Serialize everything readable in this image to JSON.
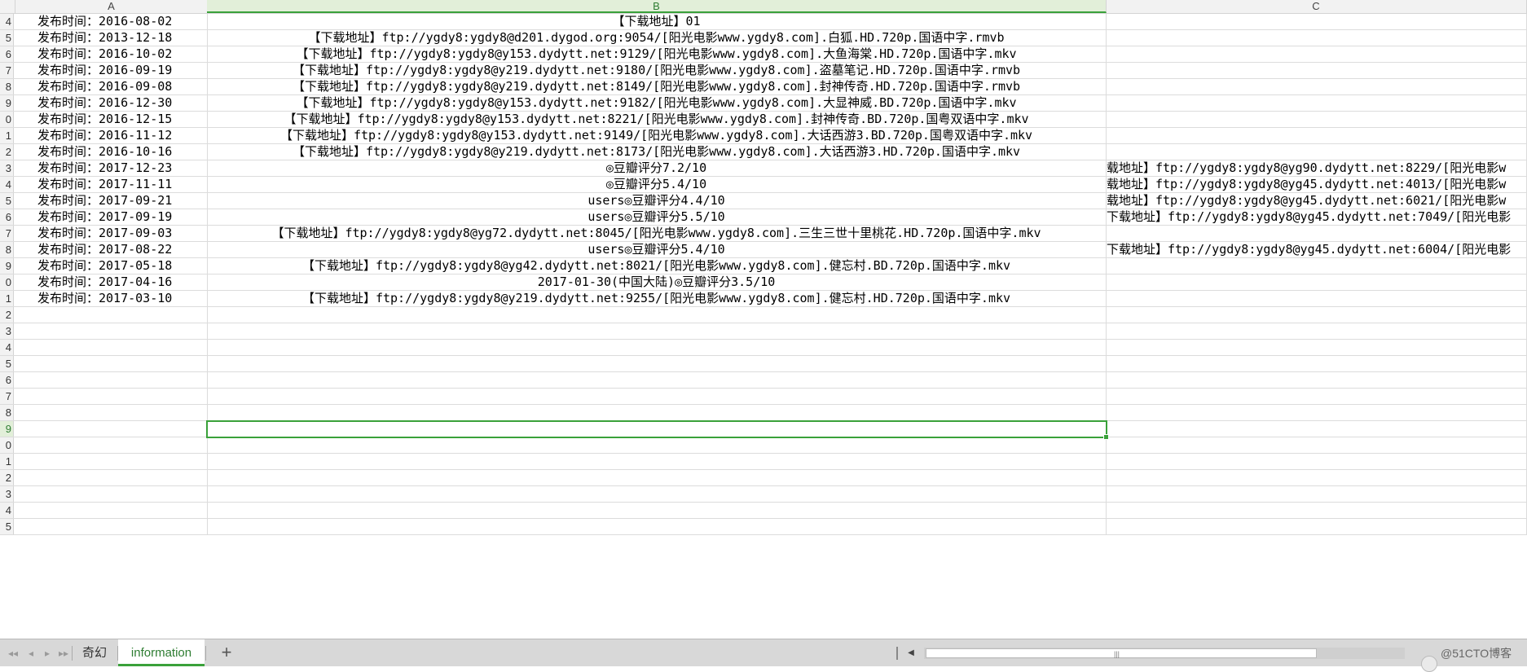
{
  "columns": {
    "a": "A",
    "b": "B",
    "c": "C"
  },
  "rows": [
    {
      "num": "4",
      "a": "发布时间：2016-08-02",
      "b": "【下载地址】01",
      "c": ""
    },
    {
      "num": "5",
      "a": "发布时间：2013-12-18",
      "b": "【下载地址】ftp://ygdy8:ygdy8@d201.dygod.org:9054/[阳光电影www.ygdy8.com].白狐.HD.720p.国语中字.rmvb",
      "c": ""
    },
    {
      "num": "6",
      "a": "发布时间：2016-10-02",
      "b": "【下载地址】ftp://ygdy8:ygdy8@y153.dydytt.net:9129/[阳光电影www.ygdy8.com].大鱼海棠.HD.720p.国语中字.mkv",
      "c": ""
    },
    {
      "num": "7",
      "a": "发布时间：2016-09-19",
      "b": "【下载地址】ftp://ygdy8:ygdy8@y219.dydytt.net:9180/[阳光电影www.ygdy8.com].盗墓笔记.HD.720p.国语中字.rmvb",
      "c": ""
    },
    {
      "num": "8",
      "a": "发布时间：2016-09-08",
      "b": "【下载地址】ftp://ygdy8:ygdy8@y219.dydytt.net:8149/[阳光电影www.ygdy8.com].封神传奇.HD.720p.国语中字.rmvb",
      "c": ""
    },
    {
      "num": "9",
      "a": "发布时间：2016-12-30",
      "b": "【下载地址】ftp://ygdy8:ygdy8@y153.dydytt.net:9182/[阳光电影www.ygdy8.com].大显神威.BD.720p.国语中字.mkv",
      "c": ""
    },
    {
      "num": "0",
      "a": "发布时间：2016-12-15",
      "b": "【下载地址】ftp://ygdy8:ygdy8@y153.dydytt.net:8221/[阳光电影www.ygdy8.com].封神传奇.BD.720p.国粤双语中字.mkv",
      "c": ""
    },
    {
      "num": "1",
      "a": "发布时间：2016-11-12",
      "b": "【下载地址】ftp://ygdy8:ygdy8@y153.dydytt.net:9149/[阳光电影www.ygdy8.com].大话西游3.BD.720p.国粤双语中字.mkv",
      "c": ""
    },
    {
      "num": "2",
      "a": "发布时间：2016-10-16",
      "b": "【下载地址】ftp://ygdy8:ygdy8@y219.dydytt.net:8173/[阳光电影www.ygdy8.com].大话西游3.HD.720p.国语中字.mkv",
      "c": ""
    },
    {
      "num": "3",
      "a": "发布时间：2017-12-23",
      "b": "◎豆瓣评分7.2/10",
      "c": "载地址】ftp://ygdy8:ygdy8@yg90.dydytt.net:8229/[阳光电影w"
    },
    {
      "num": "4",
      "a": "发布时间：2017-11-11",
      "b": "◎豆瓣评分5.4/10",
      "c": "载地址】ftp://ygdy8:ygdy8@yg45.dydytt.net:4013/[阳光电影w"
    },
    {
      "num": "5",
      "a": "发布时间：2017-09-21",
      "b": "users◎豆瓣评分4.4/10",
      "c": "载地址】ftp://ygdy8:ygdy8@yg45.dydytt.net:6021/[阳光电影w"
    },
    {
      "num": "6",
      "a": "发布时间：2017-09-19",
      "b": "users◎豆瓣评分5.5/10",
      "c": "下载地址】ftp://ygdy8:ygdy8@yg45.dydytt.net:7049/[阳光电影"
    },
    {
      "num": "7",
      "a": "发布时间：2017-09-03",
      "b": "【下载地址】ftp://ygdy8:ygdy8@yg72.dydytt.net:8045/[阳光电影www.ygdy8.com].三生三世十里桃花.HD.720p.国语中字.mkv",
      "c": ""
    },
    {
      "num": "8",
      "a": "发布时间：2017-08-22",
      "b": "users◎豆瓣评分5.4/10",
      "c": "下载地址】ftp://ygdy8:ygdy8@yg45.dydytt.net:6004/[阳光电影"
    },
    {
      "num": "9",
      "a": "发布时间：2017-05-18",
      "b": "【下载地址】ftp://ygdy8:ygdy8@yg42.dydytt.net:8021/[阳光电影www.ygdy8.com].健忘村.BD.720p.国语中字.mkv",
      "c": ""
    },
    {
      "num": "0",
      "a": "发布时间：2017-04-16",
      "b": "2017-01-30(中国大陆)◎豆瓣评分3.5/10",
      "c": ""
    },
    {
      "num": "1",
      "a": "发布时间：2017-03-10",
      "b": "【下载地址】ftp://ygdy8:ygdy8@y219.dydytt.net:9255/[阳光电影www.ygdy8.com].健忘村.HD.720p.国语中字.mkv",
      "c": ""
    },
    {
      "num": "2",
      "a": "",
      "b": "",
      "c": ""
    },
    {
      "num": "3",
      "a": "",
      "b": "",
      "c": ""
    },
    {
      "num": "4",
      "a": "",
      "b": "",
      "c": ""
    },
    {
      "num": "5",
      "a": "",
      "b": "",
      "c": ""
    },
    {
      "num": "6",
      "a": "",
      "b": "",
      "c": ""
    },
    {
      "num": "7",
      "a": "",
      "b": "",
      "c": ""
    },
    {
      "num": "8",
      "a": "",
      "b": "",
      "c": ""
    },
    {
      "num": "9",
      "a": "",
      "b": "",
      "c": "",
      "selected": true
    },
    {
      "num": "0",
      "a": "",
      "b": "",
      "c": ""
    },
    {
      "num": "1",
      "a": "",
      "b": "",
      "c": ""
    },
    {
      "num": "2",
      "a": "",
      "b": "",
      "c": ""
    },
    {
      "num": "3",
      "a": "",
      "b": "",
      "c": ""
    },
    {
      "num": "4",
      "a": "",
      "b": "",
      "c": ""
    },
    {
      "num": "5",
      "a": "",
      "b": "",
      "c": ""
    }
  ],
  "tabs": [
    {
      "label": "奇幻",
      "active": false
    },
    {
      "label": "information",
      "active": true
    }
  ],
  "add_sheet_label": "+",
  "watermark": "@51CTO博客",
  "colors": {
    "accent": "#3aa13a",
    "header_bg": "#f2f2f2",
    "grid": "#dcdcdc"
  }
}
